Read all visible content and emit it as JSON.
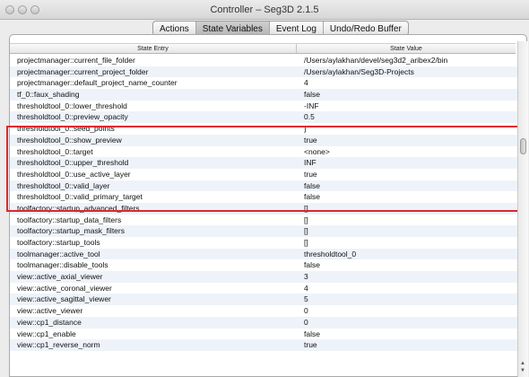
{
  "window": {
    "title": "Controller – Seg3D  2.1.5"
  },
  "tabs": [
    {
      "label": "Actions",
      "selected": false
    },
    {
      "label": "State Variables",
      "selected": true
    },
    {
      "label": "Event Log",
      "selected": false
    },
    {
      "label": "Undo/Redo Buffer",
      "selected": false
    }
  ],
  "table": {
    "columns": [
      "State Entry",
      "State Value"
    ],
    "rows": [
      {
        "entry": "projectmanager::current_file_folder",
        "value": "/Users/aylakhan/devel/seg3d2_aribex2/bin"
      },
      {
        "entry": "projectmanager::current_project_folder",
        "value": "/Users/aylakhan/Seg3D-Projects"
      },
      {
        "entry": "projectmanager::default_project_name_counter",
        "value": "4"
      },
      {
        "entry": "tf_0::faux_shading",
        "value": "false"
      },
      {
        "entry": "thresholdtool_0::lower_threshold",
        "value": "-INF"
      },
      {
        "entry": "thresholdtool_0::preview_opacity",
        "value": "0.5"
      },
      {
        "entry": "thresholdtool_0::seed_points",
        "value": "]"
      },
      {
        "entry": "thresholdtool_0::show_preview",
        "value": "true"
      },
      {
        "entry": "thresholdtool_0::target",
        "value": "<none>"
      },
      {
        "entry": "thresholdtool_0::upper_threshold",
        "value": "INF"
      },
      {
        "entry": "thresholdtool_0::use_active_layer",
        "value": "true"
      },
      {
        "entry": "thresholdtool_0::valid_layer",
        "value": "false"
      },
      {
        "entry": "thresholdtool_0::valid_primary_target",
        "value": "false"
      },
      {
        "entry": "toolfactory::startup_advanced_filters",
        "value": "[]"
      },
      {
        "entry": "toolfactory::startup_data_filters",
        "value": "[]"
      },
      {
        "entry": "toolfactory::startup_mask_filters",
        "value": "[]"
      },
      {
        "entry": "toolfactory::startup_tools",
        "value": "[]"
      },
      {
        "entry": "toolmanager::active_tool",
        "value": "thresholdtool_0"
      },
      {
        "entry": "toolmanager::disable_tools",
        "value": "false"
      },
      {
        "entry": "view::active_axial_viewer",
        "value": "3"
      },
      {
        "entry": "view::active_coronal_viewer",
        "value": "4"
      },
      {
        "entry": "view::active_sagittal_viewer",
        "value": "5"
      },
      {
        "entry": "view::active_viewer",
        "value": "0"
      },
      {
        "entry": "view::cp1_distance",
        "value": "0"
      },
      {
        "entry": "view::cp1_enable",
        "value": "false"
      },
      {
        "entry": "view::cp1_reverse_norm",
        "value": "true"
      }
    ]
  },
  "highlight_color": "#e0262e"
}
